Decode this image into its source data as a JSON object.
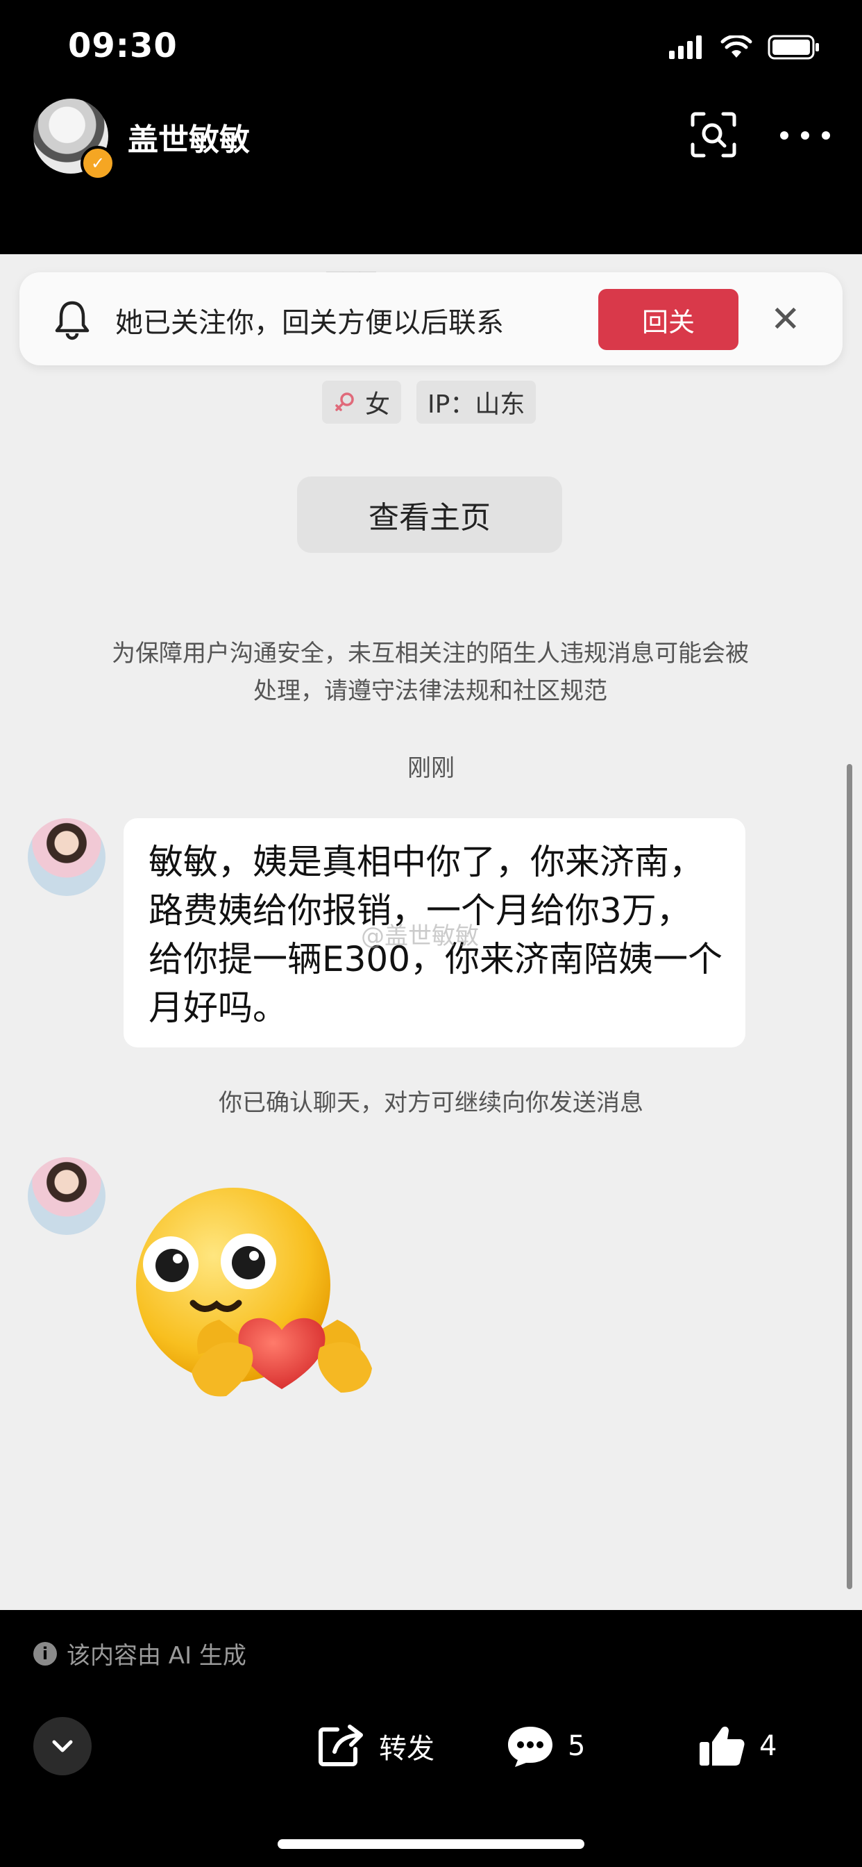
{
  "status_bar": {
    "time": "09:30"
  },
  "header": {
    "user_name": "盖世敏敏"
  },
  "banner": {
    "text": "她已关注你，回关方便以后联系",
    "follow_back_label": "回关",
    "close_glyph": "✕"
  },
  "profile": {
    "gender": "女",
    "ip_label": "IP：山东",
    "view_profile_label": "查看主页"
  },
  "notice": "为保障用户沟通安全，未互相关注的陌生人违规消息可能会被处理，请遵守法律法规和社区规范",
  "chat": {
    "time_label": "刚刚",
    "message": "敏敏，姨是真相中你了，你来济南，路费姨给你报销，一个月给你3万，给你提一辆E300，你来济南陪姨一个月好吗。",
    "confirm_text": "你已确认聊天，对方可继续向你发送消息",
    "watermark": "@盖世敏敏",
    "sticker_icon": "smiley-holding-heart-icon"
  },
  "footer": {
    "ai_note": "该内容由 AI 生成",
    "share_label": "转发",
    "comment_count": "5",
    "like_count": "4"
  },
  "colors": {
    "accent_red": "#d9394a",
    "verified_orange": "#f5a623"
  }
}
